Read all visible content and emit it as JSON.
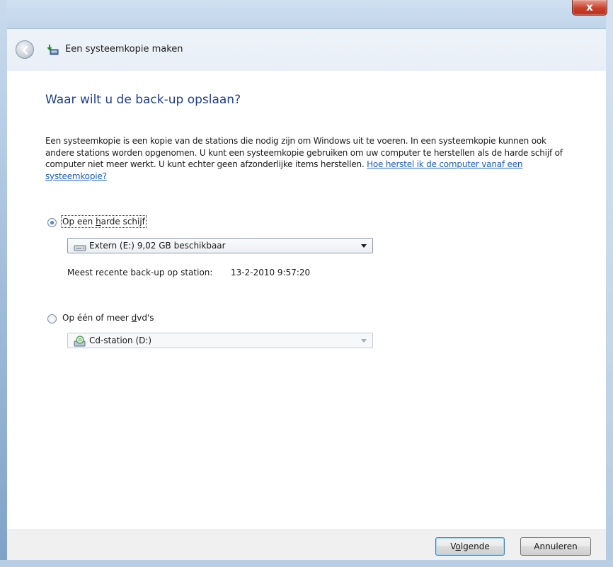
{
  "window": {
    "title": "Een systeemkopie maken",
    "close_symbol": "x"
  },
  "page": {
    "heading": "Waar wilt u de back-up opslaan?",
    "description": "Een systeemkopie is een kopie van de stations die nodig zijn om Windows uit te voeren. In een systeemkopie kunnen ook andere stations worden opgenomen. U kunt een systeemkopie gebruiken om uw computer te herstellen als de harde schijf of computer niet meer werkt. U kunt echter geen afzonderlijke items herstellen.",
    "help_link": "Hoe herstel ik de computer vanaf een systeemkopie?"
  },
  "options": {
    "harddisk": {
      "label_pre": "Op een ",
      "label_accel": "h",
      "label_post": "arde schijf",
      "checked": true,
      "dropdown_value": "Extern (E:) 9,02 GB beschikbaar",
      "last_backup_label": "Meest recente back-up op station:",
      "last_backup_value": "13-2-2010 9:57:20"
    },
    "dvd": {
      "label_pre": "Op één of meer ",
      "label_accel": "d",
      "label_post": "vd's",
      "checked": false,
      "dropdown_value": "Cd-station (D:)"
    }
  },
  "buttons": {
    "next_pre": "V",
    "next_accel": "o",
    "next_post": "lgende",
    "cancel": "Annuleren"
  },
  "icons": {
    "back": "back-arrow-icon",
    "title": "backup-icon",
    "harddisk": "drive-icon",
    "dvd": "cd-drive-icon"
  },
  "colors": {
    "heading": "#1e3f8c",
    "link": "#1a5fbf",
    "close": "#c9412d"
  }
}
